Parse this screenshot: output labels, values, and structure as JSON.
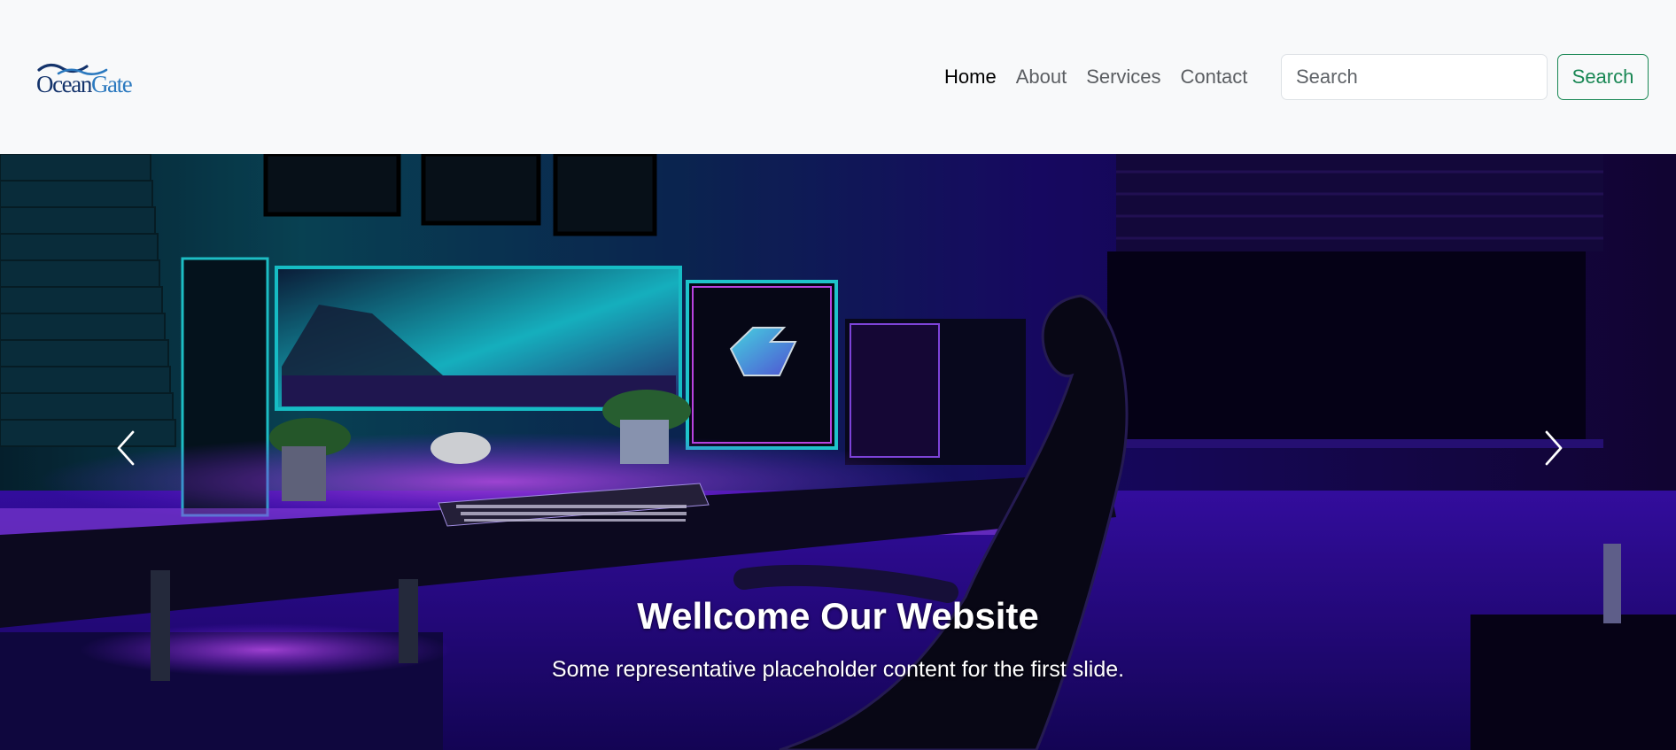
{
  "brand": {
    "name_part1": "Ocean",
    "name_part2": "Gate",
    "icon": "ocean-wave-logo",
    "colors": {
      "primary": "#14336b",
      "accent": "#2b79bf"
    }
  },
  "nav": {
    "links": [
      {
        "label": "Home",
        "active": true
      },
      {
        "label": "About",
        "active": false
      },
      {
        "label": "Services",
        "active": false
      },
      {
        "label": "Contact",
        "active": false
      }
    ]
  },
  "search": {
    "placeholder": "Search",
    "value": "",
    "button_label": "Search",
    "button_color": "#198754"
  },
  "carousel": {
    "slide": {
      "title": "Wellcome Our Website",
      "text": "Some representative placeholder content for the first slide.",
      "image": "gaming-setup-purple-neon"
    },
    "prev_icon": "chevron-left-icon",
    "next_icon": "chevron-right-icon"
  }
}
